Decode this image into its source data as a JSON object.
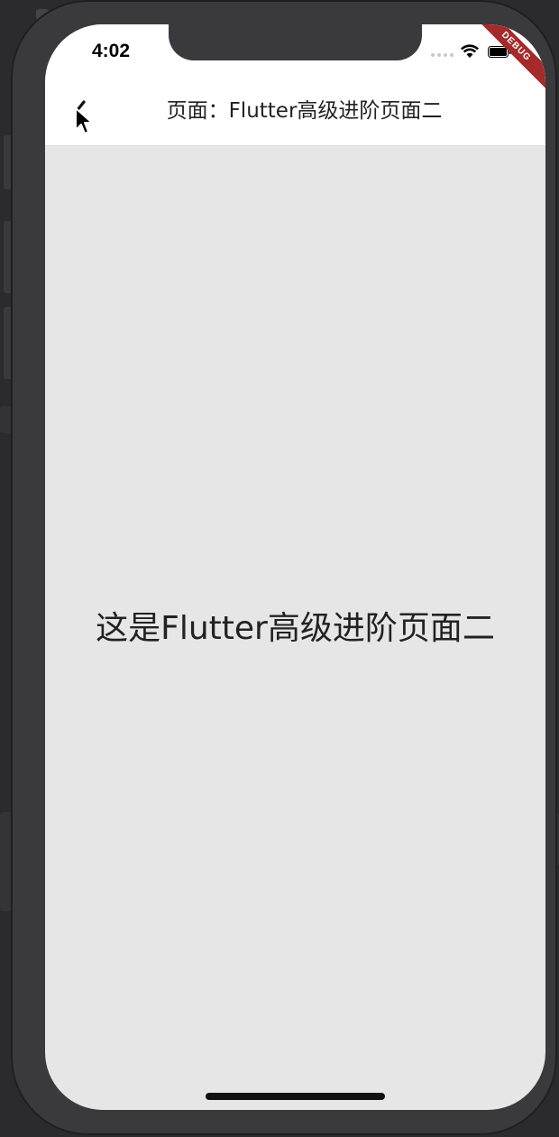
{
  "status_bar": {
    "time": "4:02",
    "icons": [
      "signal-dots-icon",
      "wifi-icon",
      "battery-icon"
    ]
  },
  "debug_banner": {
    "label": "DEBUG",
    "color": "#a52a2a"
  },
  "app_bar": {
    "back_icon": "chevron-left-icon",
    "title": "页面：Flutter高级进阶页面二",
    "background": "#ffffff"
  },
  "content": {
    "text": "这是Flutter高级进阶页面二",
    "background": "#e6e6e6"
  }
}
